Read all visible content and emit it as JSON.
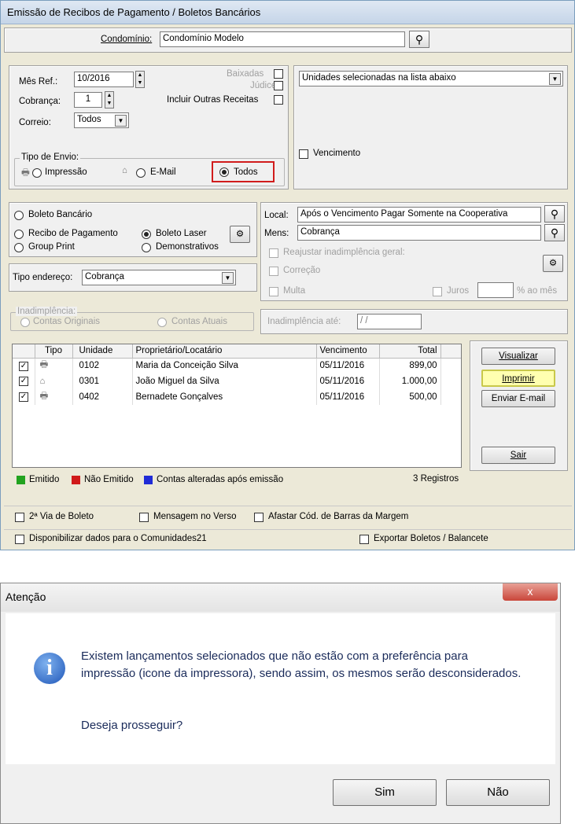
{
  "window": {
    "title": "Emissão de Recibos de Pagamento / Boletos Bancários"
  },
  "condominio": {
    "label": "Condomínio:",
    "value": "Condomínio Modelo"
  },
  "filters": {
    "mes_ref_label": "Mês Ref.:",
    "mes_ref_value": "10/2016",
    "cobranca_label": "Cobrança:",
    "cobranca_value": "1",
    "correio_label": "Correio:",
    "correio_value": "Todos",
    "baixadas_label": "Baixadas",
    "judice_label": "Júdice",
    "incluir_label": "Incluir Outras Receitas",
    "tipo_envio_title": "Tipo de Envio:",
    "impressao_label": "Impressão",
    "email_label": "E-Mail",
    "todos_label": "Todos",
    "unidades_value": "Unidades selecionadas na lista abaixo",
    "vencimento_label": "Vencimento"
  },
  "options": {
    "boleto_bancario": "Boleto Bancário",
    "recibo": "Recibo de Pagamento",
    "group_print": "Group Print",
    "boleto_laser": "Boleto Laser",
    "demonstrativos": "Demonstrativos",
    "tipo_endereco_label": "Tipo endereço:",
    "tipo_endereco_value": "Cobrança",
    "inadimplencia_title": "Inadimplência:",
    "contas_originais": "Contas Originais",
    "contas_atuais": "Contas Atuais"
  },
  "messages": {
    "local_label": "Local:",
    "local_value": "Após o Vencimento Pagar Somente na Cooperativa",
    "mens_label": "Mens:",
    "mens_value": "Cobrança",
    "reajustar_label": "Reajustar inadimplência geral:",
    "correcao_label": "Correção",
    "multa_label": "Multa",
    "juros_label": "Juros",
    "ao_mes_label": "% ao mês",
    "inad_ate_label": "Inadimplência até:",
    "inad_ate_value": "/ /"
  },
  "table": {
    "headers": [
      "Tipo",
      "Unidade",
      "Proprietário/Locatário",
      "Vencimento",
      "Total"
    ],
    "rows": [
      {
        "unidade": "0102",
        "nome": "Maria da Conceição Silva",
        "venc": "05/11/2016",
        "total": "899,00",
        "icon": "printer-icon"
      },
      {
        "unidade": "0301",
        "nome": "João Miguel da Silva",
        "venc": "05/11/2016",
        "total": "1.000,00",
        "icon": "mail-icon"
      },
      {
        "unidade": "0402",
        "nome": "Bernadete Gonçalves",
        "venc": "05/11/2016",
        "total": "500,00",
        "icon": "printer-icon"
      }
    ]
  },
  "actions": {
    "visualizar": "Visualizar",
    "imprimir": "Imprimir",
    "enviar": "Enviar E-mail",
    "sair": "Sair"
  },
  "legend": {
    "emitido": "Emitido",
    "nao_emitido": "Não Emitido",
    "alteradas": "Contas alteradas após emissão",
    "registros": "3 Registros",
    "colors": {
      "emitido": "#22a31f",
      "nao_emitido": "#d01a1a",
      "alteradas": "#1f2bd6"
    }
  },
  "footer": {
    "segunda_via": "2ª Via de Boleto",
    "mensagem_verso": "Mensagem no Verso",
    "afastar": "Afastar Cód. de Barras da Margem",
    "disponibilizar": "Disponibilizar dados para o Comunidades21",
    "exportar": "Exportar Boletos / Balancete"
  },
  "dialog": {
    "title": "Atenção",
    "message": "Existem lançamentos selecionados que não estão com a preferência para impressão (icone da impressora), sendo assim, os mesmos serão desconsiderados.",
    "question": "Deseja prosseguir?",
    "yes": "Sim",
    "no": "Não"
  }
}
